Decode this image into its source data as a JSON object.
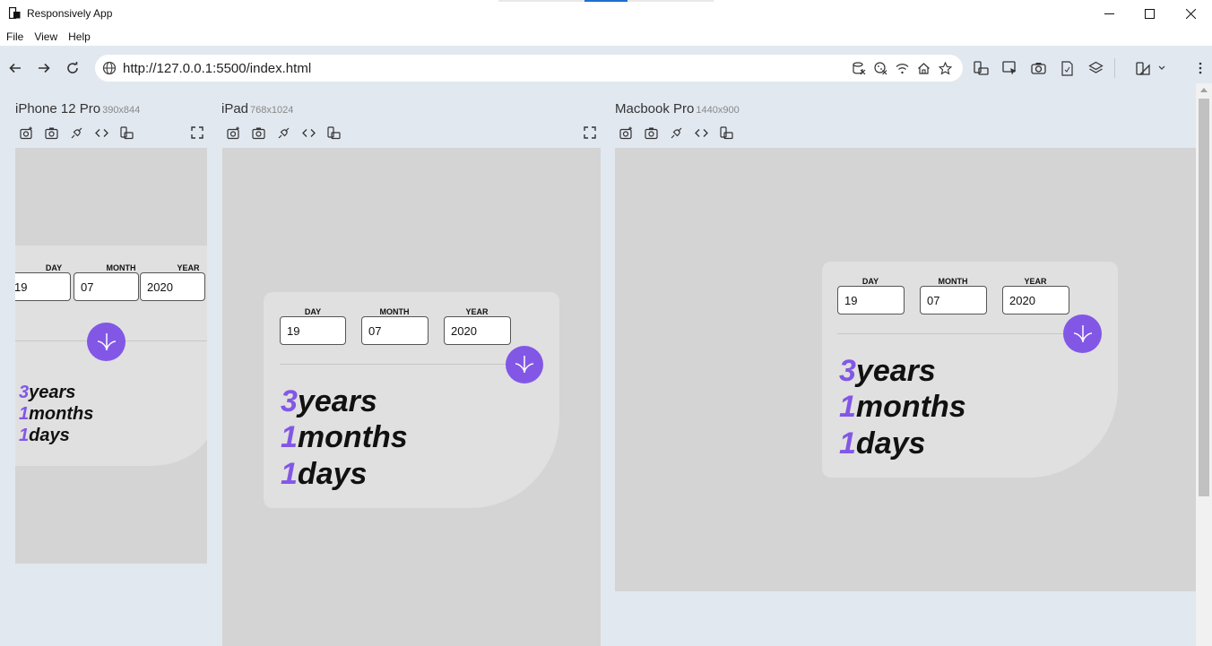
{
  "window": {
    "title": "Responsively App",
    "controls": [
      "minimize-icon",
      "maximize-icon",
      "close-icon"
    ]
  },
  "menu": {
    "items": [
      "File",
      "View",
      "Help"
    ]
  },
  "address_bar": {
    "url": "http://127.0.0.1:5500/index.html"
  },
  "devices": [
    {
      "name": "iPhone 12 Pro",
      "resolution": "390x844"
    },
    {
      "name": "iPad",
      "resolution": "768x1024"
    },
    {
      "name": "Macbook Pro",
      "resolution": "1440x900"
    }
  ],
  "form": {
    "day_label": "DAY",
    "month_label": "MONTH",
    "year_label": "YEAR",
    "day_value": "19",
    "month_value": "07",
    "year_value": "2020"
  },
  "results": {
    "years_num": "3",
    "years_unit": "years",
    "months_num": "1",
    "months_unit": "months",
    "days_num": "1",
    "days_unit": "days"
  },
  "colors": {
    "accent": "#8257e6",
    "card": "#e0e0e0",
    "viewport": "#d4d4d4",
    "app_background": "#e2e8f0"
  }
}
